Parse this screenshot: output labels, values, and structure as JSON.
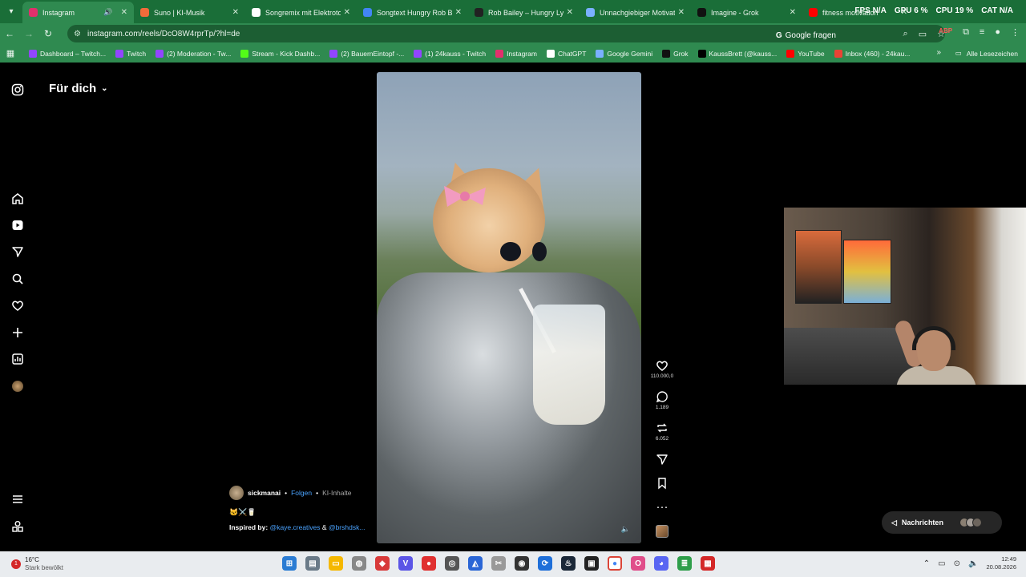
{
  "browser": {
    "tabs": [
      {
        "title": "Instagram",
        "active": true,
        "favicon_color": "#e1306c",
        "audio": true
      },
      {
        "title": "Suno | KI-Musik",
        "active": false,
        "favicon_color": "#f26b3a"
      },
      {
        "title": "Songremix mit Elektrotou",
        "active": false,
        "favicon_color": "#ffffff"
      },
      {
        "title": "Songtext Hungry Rob Bai",
        "active": false,
        "favicon_color": "#4285f4"
      },
      {
        "title": "Rob Bailey – Hungry Lyric",
        "active": false,
        "favicon_color": "#222222"
      },
      {
        "title": "Unnachgiebiger Motivati",
        "active": false,
        "favicon_color": "#7ab0ff"
      },
      {
        "title": "Imagine - Grok",
        "active": false,
        "favicon_color": "#111111"
      },
      {
        "title": "fitness motivation",
        "active": false,
        "favicon_color": "#ff0000"
      }
    ],
    "perf": {
      "fps": "FPS N/A",
      "gpu": "GPU 6 %",
      "cpu": "CPU 19 %",
      "cat": "CAT N/A"
    },
    "url": "instagram.com/reels/DcO8W4rprTp/?hl=de",
    "ask_google": "Google fragen",
    "bookmarks": [
      {
        "label": "Dashboard – Twitch...",
        "color": "#9146ff"
      },
      {
        "label": "Twitch",
        "color": "#9146ff"
      },
      {
        "label": "(2) Moderation - Tw...",
        "color": "#9146ff"
      },
      {
        "label": "Stream - Kick Dashb...",
        "color": "#53fc18"
      },
      {
        "label": "(2) BauernEintopf -...",
        "color": "#9146ff"
      },
      {
        "label": "(1) 24kauss - Twitch",
        "color": "#9146ff"
      },
      {
        "label": "Instagram",
        "color": "#e1306c"
      },
      {
        "label": "ChatGPT",
        "color": "#ffffff"
      },
      {
        "label": "Google Gemini",
        "color": "#7ab0ff"
      },
      {
        "label": "Grok",
        "color": "#111111"
      },
      {
        "label": "KaussBrett (@kauss...",
        "color": "#000000"
      },
      {
        "label": "YouTube",
        "color": "#ff0000"
      },
      {
        "label": "Inbox (460) - 24kau...",
        "color": "#ea4335"
      }
    ],
    "all_bookmarks": "Alle Lesezeichen"
  },
  "instagram": {
    "feed_title": "Für dich",
    "sidebar_icons": [
      "instagram-icon",
      "home-icon",
      "reels-icon",
      "send-icon",
      "search-icon",
      "heart-icon",
      "create-icon",
      "dashboard-icon",
      "profile-avatar",
      "menu-icon",
      "more-icon"
    ],
    "actions": {
      "likes": "110.000,0",
      "comments": "1.189",
      "reposts": "6.052"
    },
    "caption": {
      "username": "sickmanai",
      "follow": "Folgen",
      "tag": "KI-Inhalte",
      "emojis": "🐱⚔️🥛",
      "inspired_prefix": "Inspired by:",
      "inspired_user1": "@kaye.creatives",
      "inspired_amp": "&",
      "inspired_user2": "@brshdsk..."
    },
    "messages_label": "Nachrichten"
  },
  "taskbar": {
    "temperature": "16°C",
    "weather": "Stark bewölkt",
    "notification_count": "1",
    "time": "12:49",
    "date": "20.08.2026"
  }
}
